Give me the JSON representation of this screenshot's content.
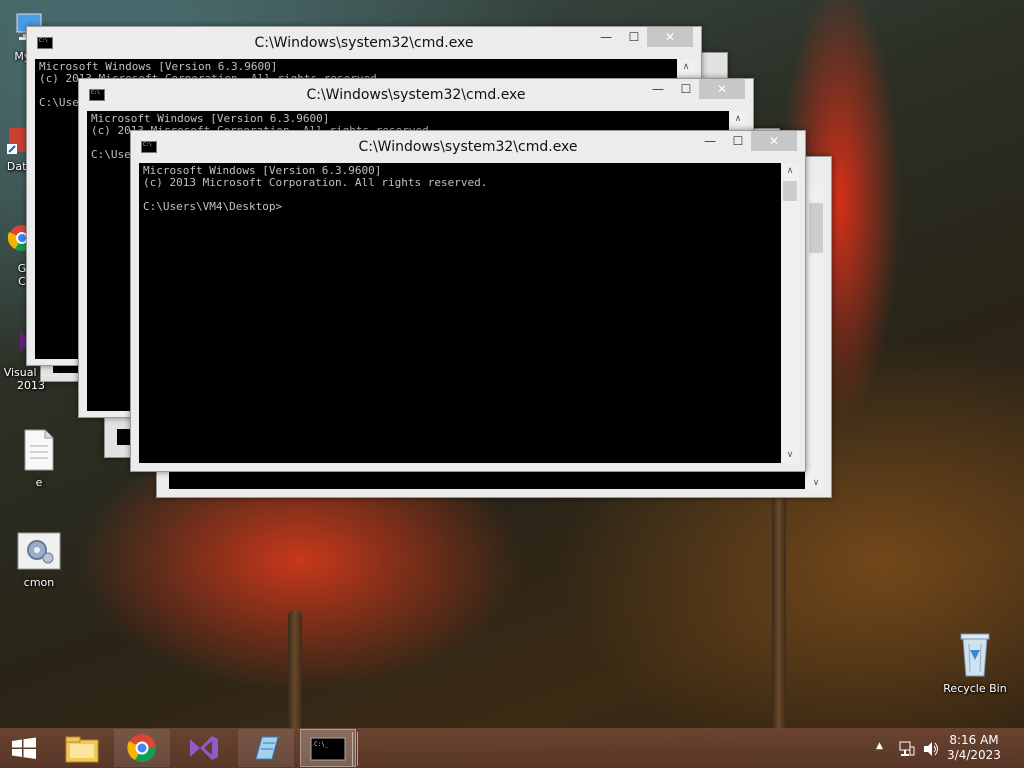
{
  "desktop": {
    "icons": [
      {
        "label": "My C"
      },
      {
        "label": "Data"
      },
      {
        "label": "G\nC"
      },
      {
        "label": "Visual Stu\n2013"
      },
      {
        "label": "e"
      },
      {
        "label": "cmon"
      },
      {
        "label": "Recycle Bin"
      }
    ]
  },
  "windows": [
    {
      "title": "C:\\Windows\\system32\\cmd.exe",
      "console_lines": "Microsoft Windows [Version 6.3.9600]\n(c) 2013 Microsoft Corporation. All rights reserved.\n\nC:\\Users\\VM4\\Desktop>"
    },
    {
      "title": "C:\\Windows\\system32\\cmd.exe",
      "console_lines": "Microsoft Windows [Version 6.3.9600]\n(c) 2013 Microsoft Corporation. All rights reserved.\n\nC:\\Users\\VM4\\Desktop>"
    },
    {
      "title": "C:\\Windows\\system32\\cmd.exe",
      "console_lines": "Microsoft Windows [Version 6.3.9600]\n(c) 2013 Microsoft Corporation. All rights reserved.\n\nC:\\Users\\VM4\\Desktop>"
    }
  ],
  "window_buttons": {
    "minimize": "—",
    "maximize": "☐",
    "close": "✕"
  },
  "taskbar": {
    "items": [
      {
        "icon": "windows-start-icon"
      },
      {
        "icon": "file-explorer-icon"
      },
      {
        "icon": "chrome-icon"
      },
      {
        "icon": "visual-studio-icon"
      },
      {
        "icon": "notepad-icon"
      },
      {
        "icon": "cmd-icon"
      }
    ],
    "tray_arrow": "▲",
    "time": "8:16 AM",
    "date": "3/4/2023"
  },
  "colors": {
    "close_button": "#c7c7c7",
    "console_bg": "#000000",
    "taskbar": "#6e4632"
  }
}
